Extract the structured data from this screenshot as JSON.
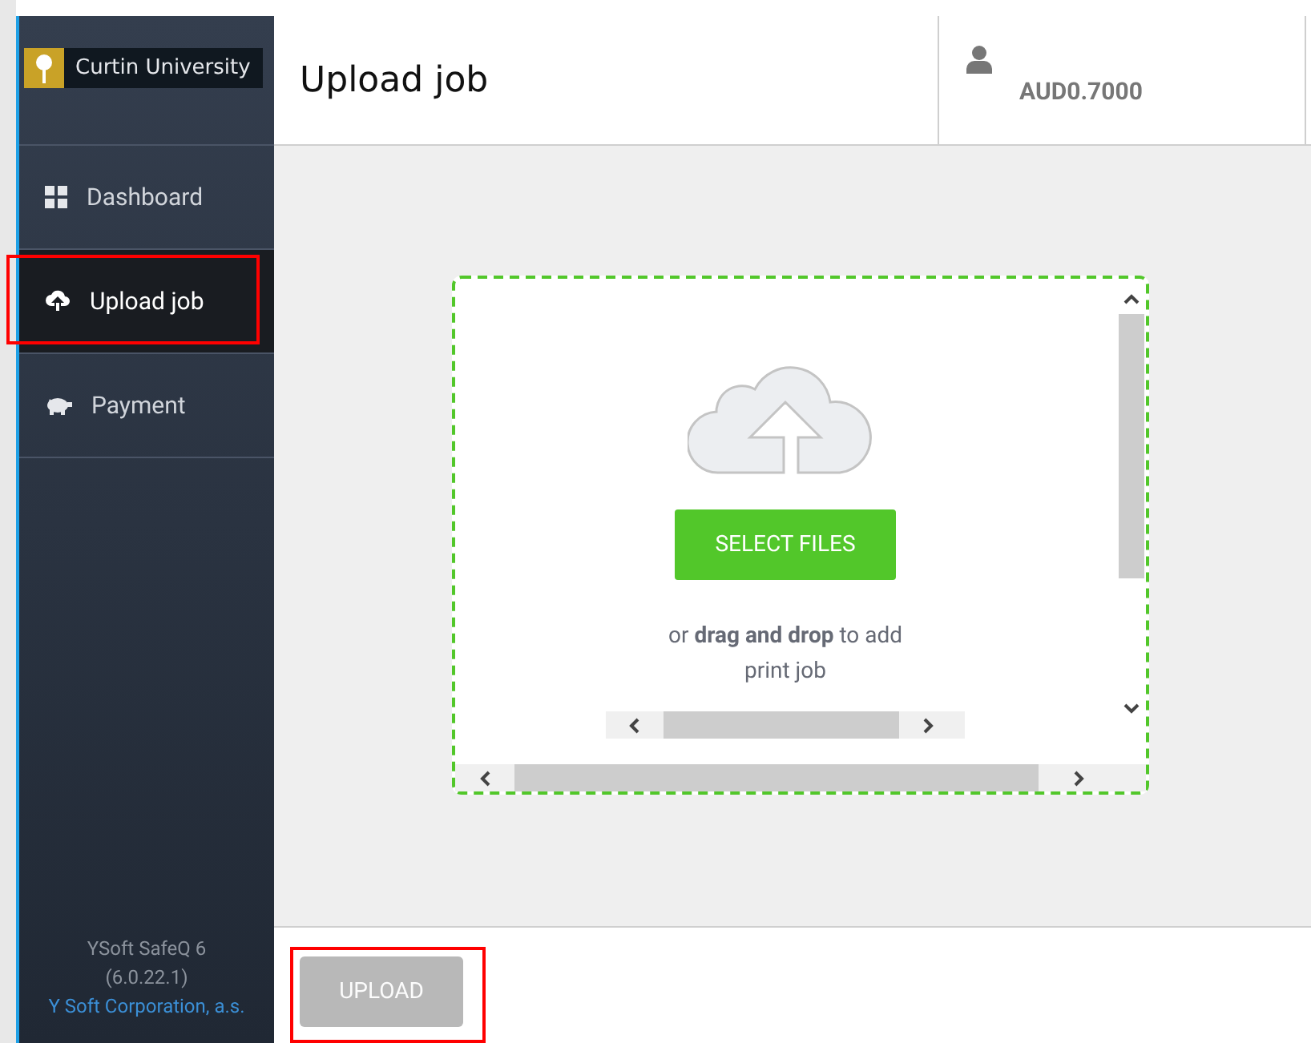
{
  "sidebar": {
    "logo_text": "Curtin University",
    "items": [
      {
        "kind": "dashboard",
        "label": "Dashboard",
        "selected": false
      },
      {
        "kind": "upload",
        "label": "Upload job",
        "selected": true
      },
      {
        "kind": "payment",
        "label": "Payment",
        "selected": false
      }
    ],
    "footer": {
      "product": "YSoft SafeQ 6",
      "version": "(6.0.22.1)",
      "link": "Y Soft Corporation, a.s."
    }
  },
  "header": {
    "title": "Upload job",
    "balance": "AUD0.7000"
  },
  "dropzone": {
    "button": "SELECT FILES",
    "hint": "or **drag and drop** to add print job"
  },
  "footer": {
    "upload_button": {
      "label": "UPLOAD",
      "disabled": true
    }
  }
}
